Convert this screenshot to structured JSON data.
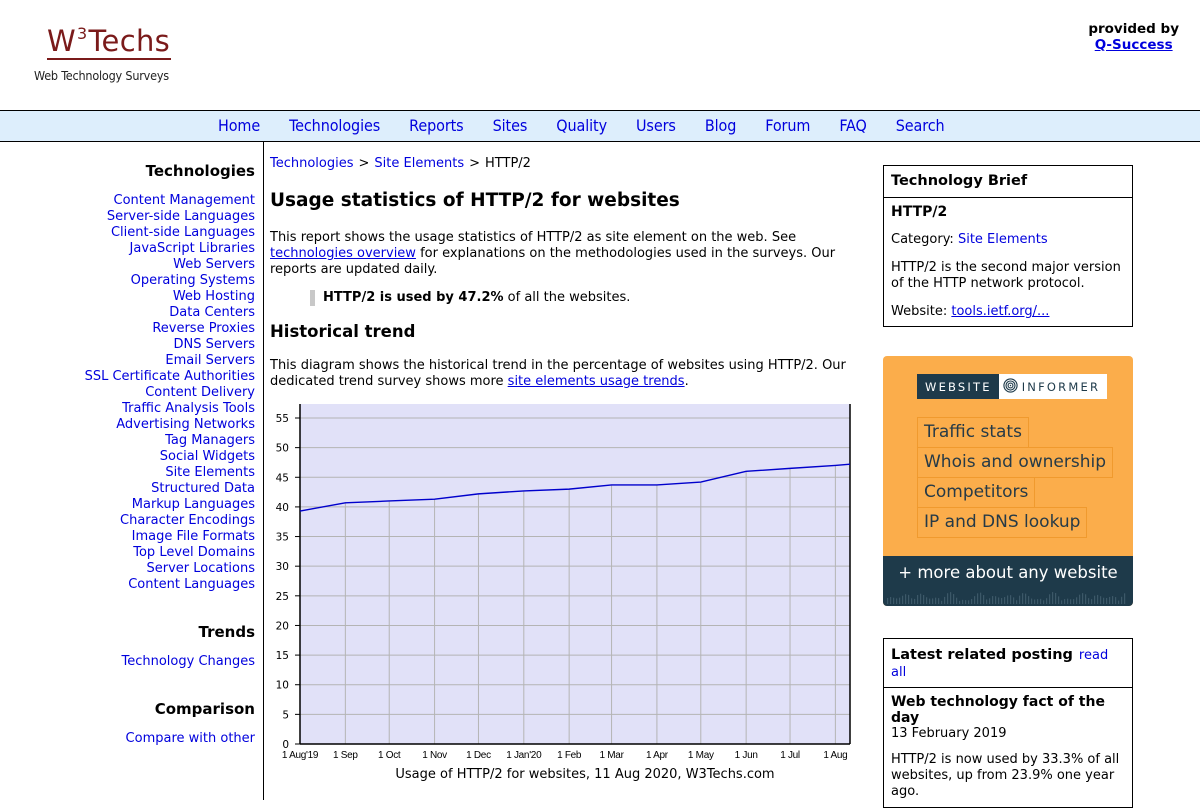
{
  "header": {
    "logo_main": "W",
    "logo_sup": "3",
    "logo_rest": "Techs",
    "logo_subtitle": "Web Technology Surveys",
    "provided_by_label": "provided by",
    "provider_link": "Q-Success"
  },
  "nav": {
    "items": [
      "Home",
      "Technologies",
      "Reports",
      "Sites",
      "Quality",
      "Users",
      "Blog",
      "Forum",
      "FAQ",
      "Search"
    ]
  },
  "sidebar": {
    "technologies_heading": "Technologies",
    "technologies": [
      "Content Management",
      "Server-side Languages",
      "Client-side Languages",
      "JavaScript Libraries",
      "Web Servers",
      "Operating Systems",
      "Web Hosting",
      "Data Centers",
      "Reverse Proxies",
      "DNS Servers",
      "Email Servers",
      "SSL Certificate Authorities",
      "Content Delivery",
      "Traffic Analysis Tools",
      "Advertising Networks",
      "Tag Managers",
      "Social Widgets",
      "Site Elements",
      "Structured Data",
      "Markup Languages",
      "Character Encodings",
      "Image File Formats",
      "Top Level Domains",
      "Server Locations",
      "Content Languages"
    ],
    "trends_heading": "Trends",
    "trends": [
      "Technology Changes"
    ],
    "comparison_heading": "Comparison",
    "comparison": [
      "Compare with other"
    ]
  },
  "main": {
    "breadcrumb": [
      "Technologies",
      "Site Elements",
      "HTTP/2"
    ],
    "breadcrumb_sep": ">",
    "title": "Usage statistics of HTTP/2 for websites",
    "intro_before_link": "This report shows the usage statistics of HTTP/2 as site element on the web. See ",
    "intro_link": "technologies overview",
    "intro_after_link": " for explanations on the methodologies used in the surveys. Our reports are updated daily.",
    "callout_bold": "HTTP/2 is used by 47.2%",
    "callout_rest": " of all the websites.",
    "trend_heading": "Historical trend",
    "trend_before_link": "This diagram shows the historical trend in the percentage of websites using HTTP/2. Our dedicated trend survey shows more ",
    "trend_link": "site elements usage trends",
    "trend_after_link": "."
  },
  "chart_data": {
    "type": "line",
    "title": "",
    "caption": "Usage of HTTP/2 for websites, 11 Aug 2020, W3Techs.com",
    "xlabel": "",
    "ylabel": "",
    "ylim": [
      0,
      55
    ],
    "yticks": [
      0,
      5,
      10,
      15,
      20,
      25,
      30,
      35,
      40,
      45,
      50,
      55
    ],
    "x_tick_labels": [
      "1 Aug'19",
      "1 Sep",
      "1 Oct",
      "1 Nov",
      "1 Dec",
      "1 Jan'20",
      "1 Feb",
      "1 Mar",
      "1 Apr",
      "1 May",
      "1 Jun",
      "1 Jul",
      "1 Aug"
    ],
    "x_tick_days": [
      0,
      31,
      61,
      92,
      122,
      153,
      184,
      213,
      244,
      274,
      305,
      335,
      366
    ],
    "x_range_days": [
      0,
      376
    ],
    "grid": true,
    "legend": "none",
    "series": [
      {
        "name": "HTTP/2",
        "color": "#0000cc",
        "x_days": [
          0,
          31,
          61,
          92,
          122,
          153,
          184,
          213,
          244,
          274,
          305,
          335,
          366,
          376
        ],
        "values": [
          39.3,
          40.7,
          41.0,
          41.3,
          42.2,
          42.7,
          43.0,
          43.7,
          43.7,
          44.2,
          46.0,
          46.5,
          47.0,
          47.2
        ]
      }
    ],
    "plot_background": "#e1e1f8",
    "grid_color": "#b4b4b4"
  },
  "brief": {
    "heading": "Technology Brief",
    "name": "HTTP/2",
    "category_label": "Category: ",
    "category_link": "Site Elements",
    "description": "HTTP/2 is the second major version of the HTTP network protocol.",
    "website_label": "Website: ",
    "website_link": "tools.ietf.org/..."
  },
  "ad": {
    "logo_left": "WEBSITE",
    "logo_right": "INFORMER",
    "items": [
      "Traffic stats",
      "Whois and ownership",
      "Competitors",
      "IP and DNS lookup"
    ],
    "footer": "+ more about any website",
    "colors": {
      "background": "#fbad4b",
      "dark": "#1e3a4a"
    }
  },
  "posting": {
    "heading": "Latest related posting",
    "read_all": "read all",
    "title": "Web technology fact of the day",
    "date": "13 February 2019",
    "text": "HTTP/2 is now used by 33.3% of all websites, up from 23.9% one year ago."
  }
}
